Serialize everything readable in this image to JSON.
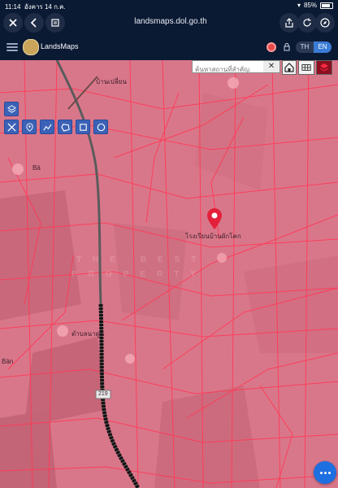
{
  "statusbar": {
    "time": "11:14",
    "date": "อังคาร 14 ก.ค.",
    "battery": "85%"
  },
  "browser": {
    "url": "landsmaps.dol.go.th"
  },
  "app": {
    "title": "LandsMaps",
    "lang": {
      "th": "TH",
      "en": "EN",
      "active": "EN"
    }
  },
  "search": {
    "placeholder": "ค้นหาสถานที่สำคัญ",
    "value": ""
  },
  "map": {
    "labels": {
      "pin": "โรงเรียนบ้านผักโคก",
      "village_top": "บ้านเปลี่ยน",
      "left_top": "Bā",
      "left_bottom": "Bān",
      "mid": "ตำบลนาดูน",
      "highway": "219"
    },
    "watermark_line1": "THE BEST",
    "watermark_line2": "PROPERTY"
  },
  "icons": {
    "close": "close-icon",
    "back": "back-icon",
    "tabs": "tabs-icon",
    "share": "share-icon",
    "reload": "reload-icon",
    "compass": "compass-icon",
    "menu": "menu-icon",
    "layers": "layers-icon",
    "measure": "measure-icon",
    "locate": "pin-icon",
    "polyline": "polyline-icon",
    "polygon": "polygon-icon",
    "rectangle": "rectangle-icon",
    "circle": "circle-icon",
    "home": "home-icon",
    "grid": "grid-icon",
    "stack": "stack-icon",
    "more": "more-icon"
  },
  "colors": {
    "accent": "#1e6fe0",
    "overlay": "#e0546b",
    "toolbar": "#3b62b7",
    "pin": "#e31f3a"
  }
}
